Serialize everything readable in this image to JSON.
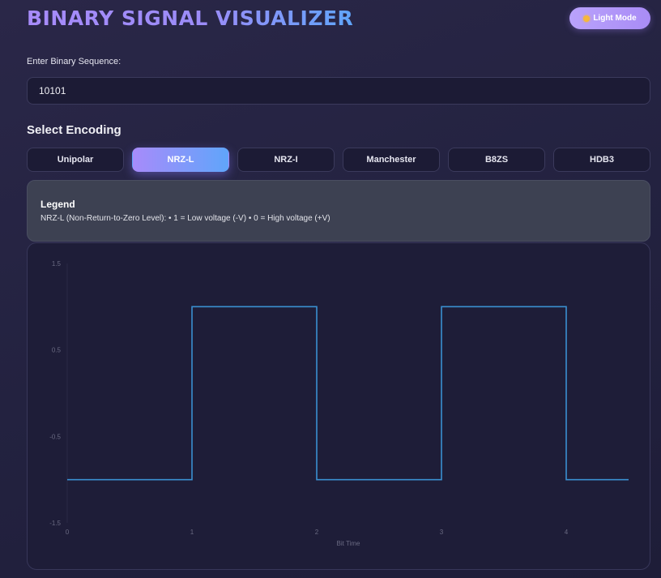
{
  "header": {
    "title": "BINARY SIGNAL VISUALIZER",
    "mode_button": "Light Mode",
    "mode_icon": "sun-icon"
  },
  "input": {
    "label": "Enter Binary Sequence:",
    "value": "10101"
  },
  "encoding": {
    "heading": "Select Encoding",
    "options": [
      "Unipolar",
      "NRZ-L",
      "NRZ-I",
      "Manchester",
      "B8ZS",
      "HDB3"
    ],
    "selected": "NRZ-L"
  },
  "legend": {
    "title": "Legend",
    "text": "NRZ-L (Non-Return-to-Zero Level): • 1 = Low voltage (-V) • 0 = High voltage (+V)"
  },
  "colors": {
    "signal_line": "#3a8fd0",
    "accent_start": "#a78bfa",
    "accent_end": "#60a5fa"
  },
  "chart_data": {
    "type": "line",
    "step": true,
    "xlabel": "Bit Time",
    "ylabel": "",
    "xlim": [
      0,
      4.5
    ],
    "ylim": [
      -1.5,
      1.5
    ],
    "x_ticks": [
      "0",
      "1",
      "2",
      "3",
      "4"
    ],
    "y_ticks": [
      "1.5",
      "0.5",
      "-0.5",
      "-1.5"
    ],
    "x": [
      0,
      1,
      1,
      2,
      2,
      3,
      3,
      4,
      4,
      4.5
    ],
    "y": [
      -1,
      -1,
      1,
      1,
      -1,
      -1,
      1,
      1,
      -1,
      -1
    ]
  }
}
